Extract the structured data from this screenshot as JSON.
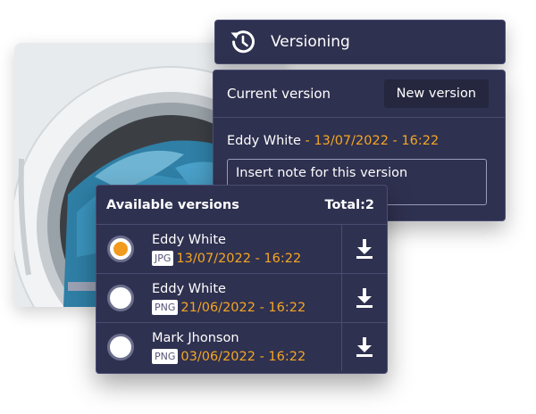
{
  "header": {
    "title": "Versioning",
    "icon": "history-icon"
  },
  "current": {
    "label": "Current version",
    "new_button": "New version",
    "author": "Eddy White",
    "date": " - 13/07/2022 - 16:22",
    "note_placeholder": "Insert note for this version"
  },
  "available": {
    "title": "Available versions",
    "total": "Total:2",
    "rows": [
      {
        "name": "Eddy White",
        "type": "JPG",
        "date": "13/07/2022 - 16:22",
        "selected": true
      },
      {
        "name": "Eddy White",
        "type": "PNG",
        "date": "21/06/2022 - 16:22",
        "selected": false
      },
      {
        "name": "Mark Jhonson",
        "type": "PNG",
        "date": "03/06/2022 - 16:22",
        "selected": false
      }
    ]
  },
  "colors": {
    "panel": "#2f3150",
    "border": "#4a4d72",
    "accent": "#f5a623",
    "selected_radio": "#f29a1e"
  }
}
